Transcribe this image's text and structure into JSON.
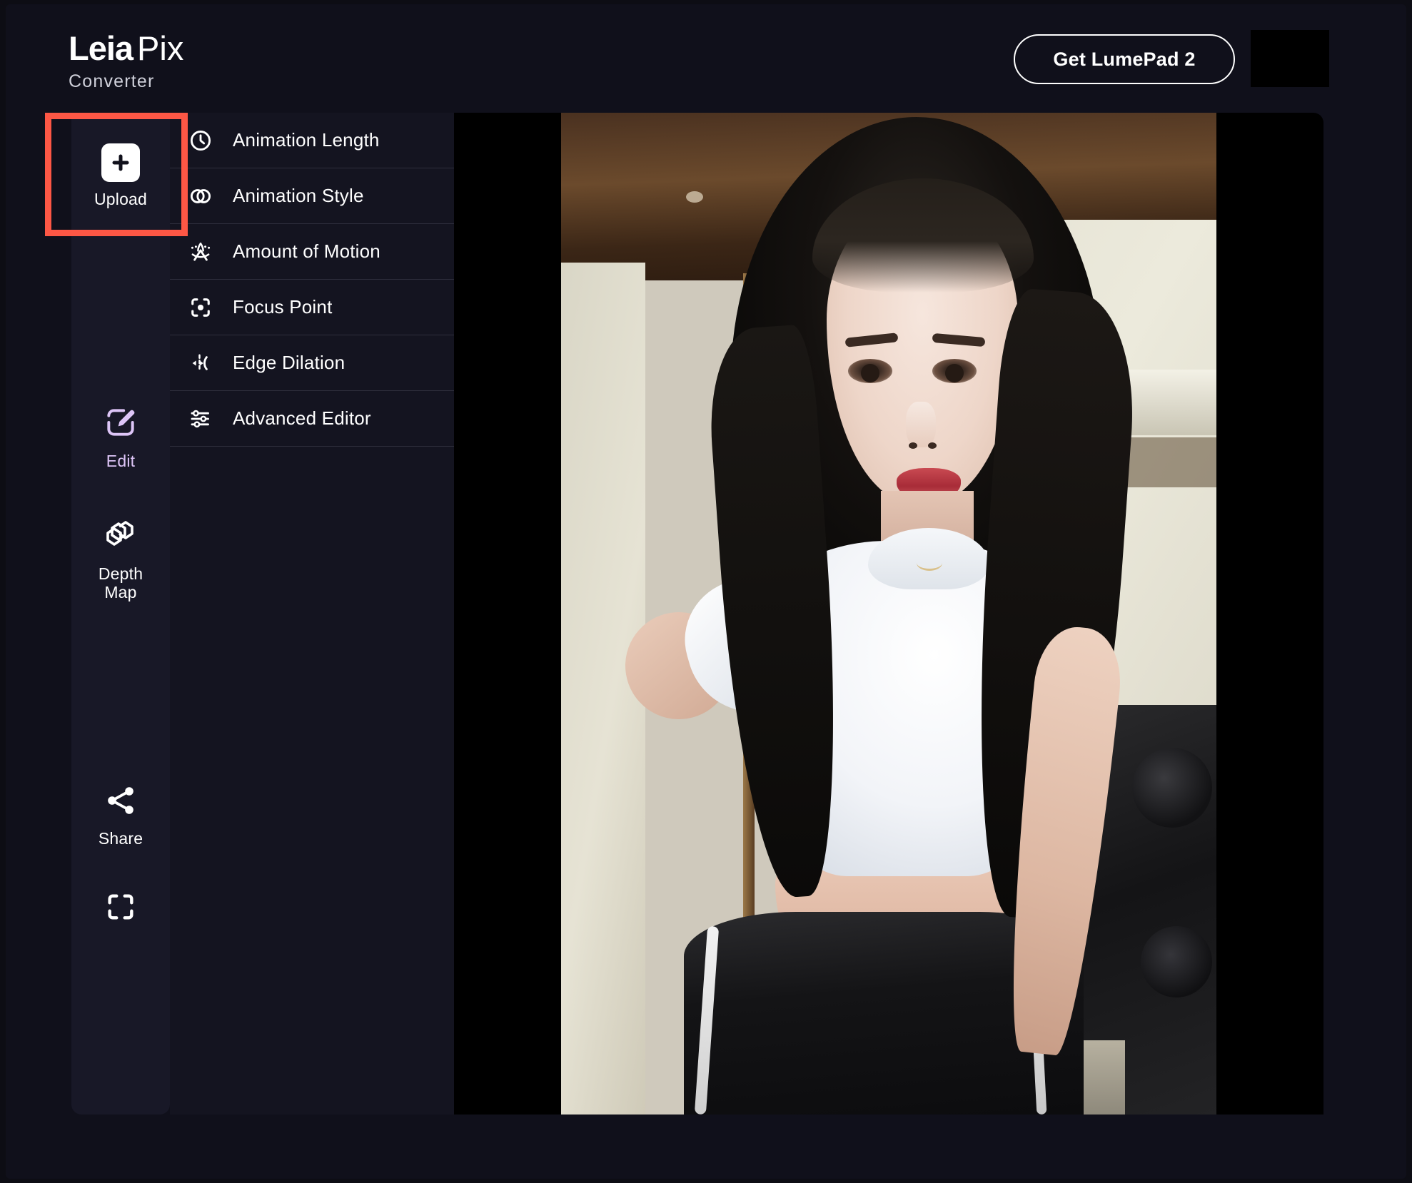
{
  "app": {
    "logo_primary": "Leia",
    "logo_secondary": "Pix",
    "logo_subtitle": "Converter"
  },
  "header": {
    "cta_label": "Get LumePad 2",
    "accent_square_color": "#000000"
  },
  "left_rail": {
    "items": [
      {
        "id": "upload",
        "label": "Upload",
        "icon": "plus-square-icon",
        "active": false,
        "highlighted": true,
        "color": "#ffffff"
      },
      {
        "id": "edit",
        "label": "Edit",
        "icon": "pencil-square-icon",
        "active": true,
        "highlighted": false,
        "color": "#ddc5f7"
      },
      {
        "id": "depth_map",
        "label": "Depth\nMap",
        "label_line1": "Depth",
        "label_line2": "Map",
        "icon": "layers-cube-icon",
        "active": false,
        "highlighted": false,
        "color": "#ffffff"
      },
      {
        "id": "share",
        "label": "Share",
        "icon": "share-nodes-icon",
        "active": false,
        "highlighted": false,
        "color": "#ffffff"
      },
      {
        "id": "fullscreen",
        "label": "",
        "icon": "fullscreen-icon",
        "active": false,
        "highlighted": false,
        "color": "#ffffff"
      }
    ]
  },
  "menu": {
    "items": [
      {
        "id": "animation_length",
        "label": "Animation Length",
        "icon": "clock-icon"
      },
      {
        "id": "animation_style",
        "label": "Animation Style",
        "icon": "overlapping-circles-icon"
      },
      {
        "id": "amount_of_motion",
        "label": "Amount of Motion",
        "icon": "motion-icon"
      },
      {
        "id": "focus_point",
        "label": "Focus Point",
        "icon": "focus-target-icon"
      },
      {
        "id": "edge_dilation",
        "label": "Edge Dilation",
        "icon": "edge-dilation-icon"
      },
      {
        "id": "advanced_editor",
        "label": "Advanced Editor",
        "icon": "sliders-icon"
      }
    ]
  },
  "viewer": {
    "background_color": "#000000",
    "media_description": "Portrait photo of a woman with long black hair wearing a white crop top and black track pants in a gym"
  },
  "annotation": {
    "target": "upload",
    "color": "#fd5745"
  },
  "colors": {
    "page_background": "#0d0d14",
    "panel_background": "#141420",
    "rail_background": "#181827",
    "accent_purple": "#ddc5f7",
    "annotation_red": "#fd5745",
    "text_primary": "#ffffff"
  }
}
